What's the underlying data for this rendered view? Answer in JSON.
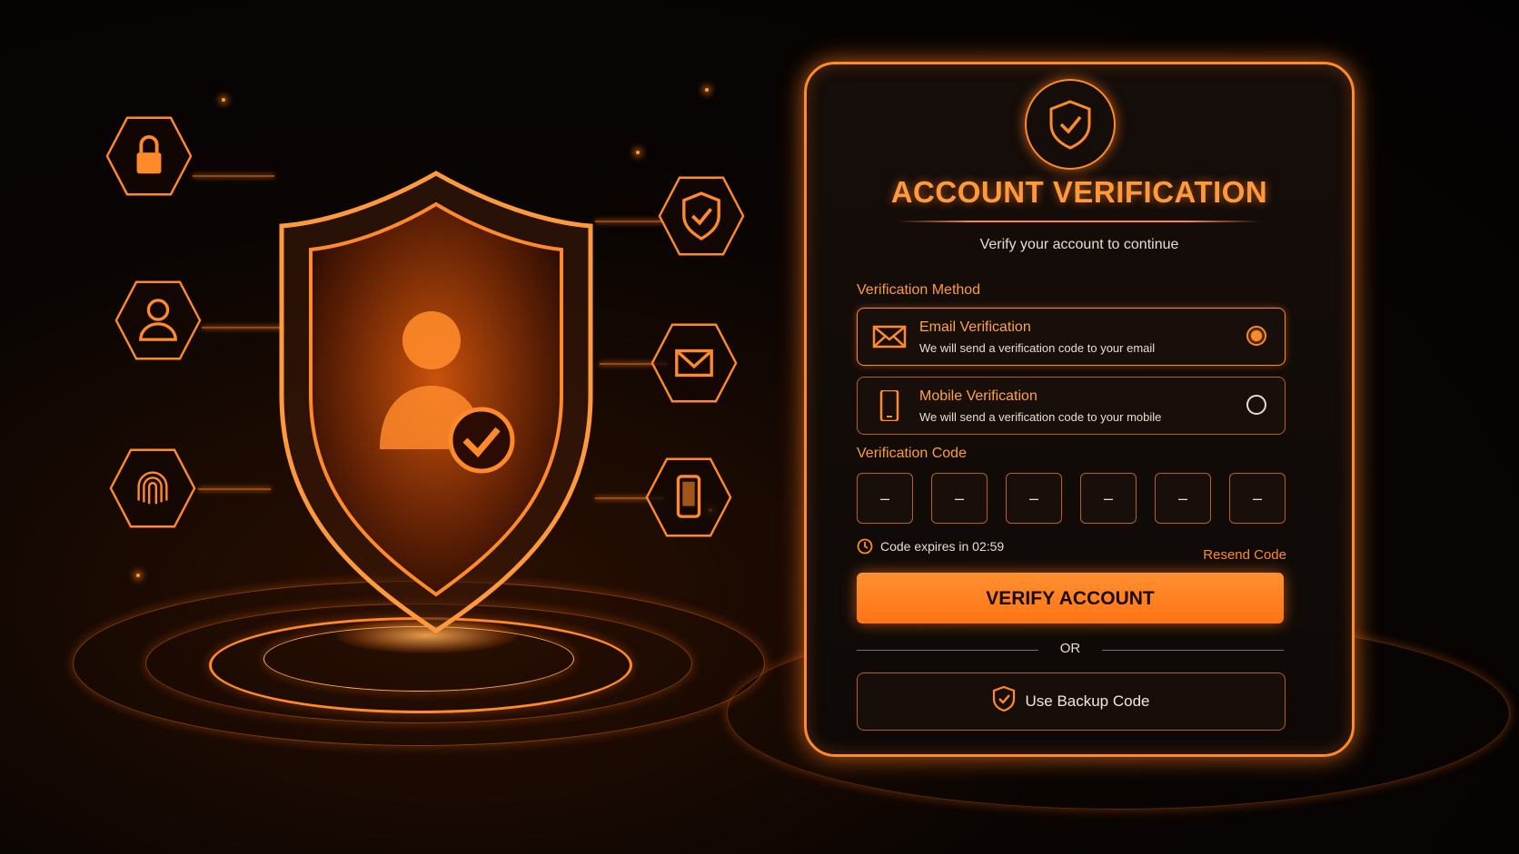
{
  "card": {
    "title": "ACCOUNT VERIFICATION",
    "subtitle": "Verify your account to continue",
    "method_label": "Verification Method",
    "options": [
      {
        "title": "Email Verification",
        "desc": "We will send a verification code to your email",
        "icon": "envelope-icon",
        "selected": true
      },
      {
        "title": "Mobile Verification",
        "desc": "We will send a verification code to your mobile",
        "icon": "mobile-phone-icon",
        "selected": false
      }
    ],
    "code_label": "Verification Code",
    "code_digits": [
      "–",
      "–",
      "–",
      "–",
      "–",
      "–"
    ],
    "timer_text": "Code expires in 02:59",
    "resend_label": "Resend Code",
    "verify_label": "VERIFY ACCOUNT",
    "or_label": "OR",
    "backup_label": "Use Backup Code"
  },
  "scene_icons": [
    "lock-icon",
    "user-icon",
    "fingerprint-icon",
    "shield-check-icon",
    "envelope-icon",
    "mobile-phone-icon",
    "shield-user-check-icon"
  ],
  "colors": {
    "accent": "#ff8a2a",
    "background": "#050303",
    "text": "#e8dcd2"
  }
}
